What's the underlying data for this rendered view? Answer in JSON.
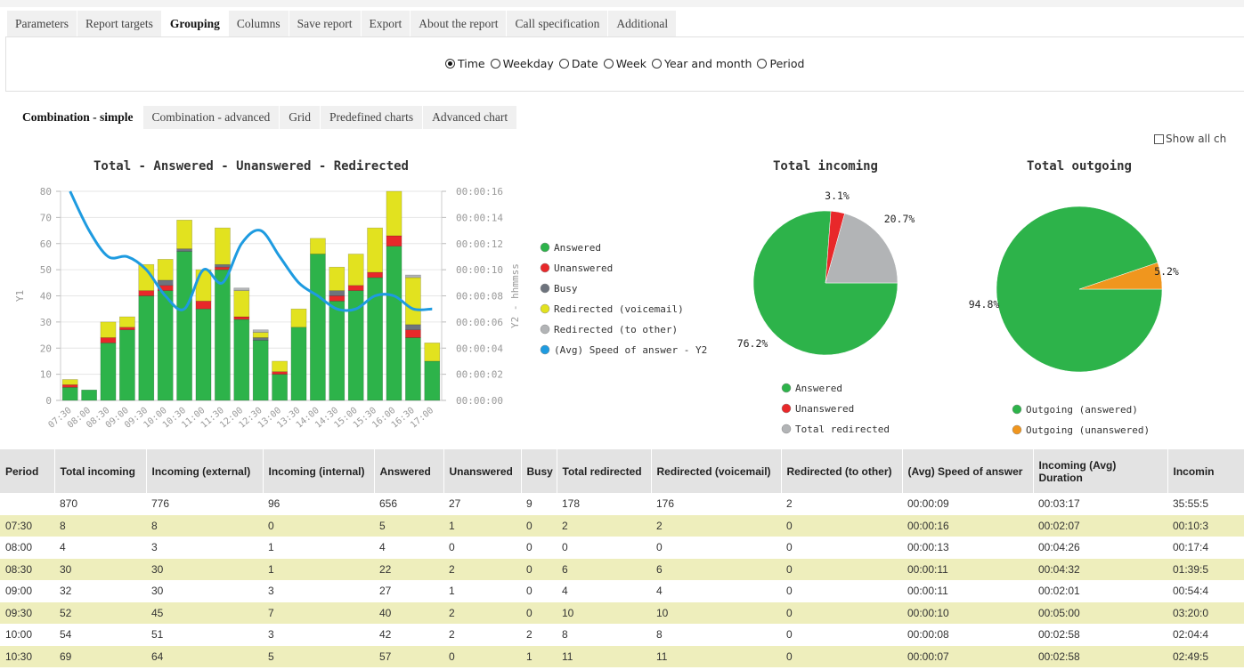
{
  "tabs_main": [
    "Parameters",
    "Report targets",
    "Grouping",
    "Columns",
    "Save report",
    "Export",
    "About the report",
    "Call specification",
    "Additional"
  ],
  "grouping_options": [
    "Time",
    "Weekday",
    "Date",
    "Week",
    "Year and month",
    "Period"
  ],
  "chart_tabs": [
    "Combination - simple",
    "Combination - advanced",
    "Grid",
    "Predefined charts",
    "Advanced chart"
  ],
  "show_all_label": "Show all ch",
  "chart_data": [
    {
      "type": "bar",
      "title": "Total - Answered - Unanswered - Redirected",
      "ylabel": "Y1",
      "y2label": "Y2 - hhmmss",
      "ylim": [
        0,
        80
      ],
      "yticks": [
        "0",
        "10",
        "20",
        "30",
        "40",
        "50",
        "60",
        "70",
        "80"
      ],
      "y2ticks": [
        "00:00:00",
        "00:00:02",
        "00:00:04",
        "00:00:06",
        "00:00:08",
        "00:00:10",
        "00:00:12",
        "00:00:14",
        "00:00:16"
      ],
      "categories": [
        "07:30",
        "08:00",
        "08:30",
        "09:00",
        "09:30",
        "10:00",
        "10:30",
        "11:00",
        "11:30",
        "12:00",
        "12:30",
        "13:00",
        "13:30",
        "14:00",
        "14:30",
        "15:00",
        "15:30",
        "16:00",
        "16:30",
        "17:00"
      ],
      "series": [
        {
          "name": "Answered",
          "color": "#2db34a",
          "values": [
            5,
            4,
            22,
            27,
            40,
            42,
            57,
            35,
            50,
            31,
            23,
            10,
            28,
            56,
            38,
            42,
            47,
            59,
            24,
            15
          ]
        },
        {
          "name": "Unanswered",
          "color": "#e8282a",
          "values": [
            1,
            0,
            2,
            1,
            2,
            2,
            0,
            3,
            1,
            1,
            0,
            1,
            0,
            0,
            2,
            2,
            2,
            4,
            3,
            0
          ]
        },
        {
          "name": "Busy",
          "color": "#6d737d",
          "values": [
            0,
            0,
            0,
            0,
            0,
            2,
            1,
            0,
            1,
            0,
            1,
            0,
            0,
            0,
            2,
            0,
            0,
            0,
            2,
            0
          ]
        },
        {
          "name": "Redirected (voicemail)",
          "color": "#e2e21f",
          "values": [
            2,
            0,
            6,
            4,
            10,
            8,
            11,
            12,
            14,
            10,
            2,
            4,
            7,
            6,
            9,
            12,
            17,
            17,
            18,
            7
          ]
        },
        {
          "name": "Redirected (to other)",
          "color": "#b2b4b6",
          "values": [
            0,
            0,
            0,
            0,
            0,
            0,
            0,
            0,
            0,
            1,
            1,
            0,
            0,
            0,
            0,
            0,
            0,
            0,
            1,
            0
          ]
        }
      ],
      "line": {
        "name": "(Avg) Speed of answer - Y2",
        "color": "#1e9be0",
        "values": [
          16,
          13,
          11,
          11,
          10,
          8,
          7,
          10,
          9,
          12,
          13,
          11,
          9,
          8,
          7,
          7,
          8,
          8,
          7,
          7
        ]
      }
    },
    {
      "type": "pie",
      "title": "Total incoming",
      "labels": [
        "Answered",
        "Unanswered",
        "Total redirected"
      ],
      "values": [
        76.2,
        3.1,
        20.7
      ],
      "value_labels": [
        "76.2%",
        "3.1%",
        "20.7%"
      ],
      "colors": [
        "#2db34a",
        "#e8282a",
        "#b2b4b6"
      ]
    },
    {
      "type": "pie",
      "title": "Total outgoing",
      "labels": [
        "Outgoing (answered)",
        "Outgoing (unanswered)"
      ],
      "values": [
        94.8,
        5.2
      ],
      "value_labels": [
        "94.8%",
        "5.2%"
      ],
      "colors": [
        "#2db34a",
        "#f0961e"
      ]
    }
  ],
  "table": {
    "headers": [
      "Period",
      "Total incoming",
      "Incoming (external)",
      "Incoming (internal)",
      "Answered",
      "Unanswered",
      "Busy",
      "Total redirected",
      "Redirected (voicemail)",
      "Redirected (to other)",
      "(Avg) Speed of answer",
      "Incoming (Avg) Duration",
      "Incomin"
    ],
    "rows": [
      [
        "",
        "870",
        "776",
        "96",
        "656",
        "27",
        "9",
        "178",
        "176",
        "2",
        "00:00:09",
        "00:03:17",
        "35:55:5"
      ],
      [
        "07:30",
        "8",
        "8",
        "0",
        "5",
        "1",
        "0",
        "2",
        "2",
        "0",
        "00:00:16",
        "00:02:07",
        "00:10:3"
      ],
      [
        "08:00",
        "4",
        "3",
        "1",
        "4",
        "0",
        "0",
        "0",
        "0",
        "0",
        "00:00:13",
        "00:04:26",
        "00:17:4"
      ],
      [
        "08:30",
        "30",
        "30",
        "1",
        "22",
        "2",
        "0",
        "6",
        "6",
        "0",
        "00:00:11",
        "00:04:32",
        "01:39:5"
      ],
      [
        "09:00",
        "32",
        "30",
        "3",
        "27",
        "1",
        "0",
        "4",
        "4",
        "0",
        "00:00:11",
        "00:02:01",
        "00:54:4"
      ],
      [
        "09:30",
        "52",
        "45",
        "7",
        "40",
        "2",
        "0",
        "10",
        "10",
        "0",
        "00:00:10",
        "00:05:00",
        "03:20:0"
      ],
      [
        "10:00",
        "54",
        "51",
        "3",
        "42",
        "2",
        "2",
        "8",
        "8",
        "0",
        "00:00:08",
        "00:02:58",
        "02:04:4"
      ],
      [
        "10:30",
        "69",
        "64",
        "5",
        "57",
        "0",
        "1",
        "11",
        "11",
        "0",
        "00:00:07",
        "00:02:58",
        "02:49:5"
      ]
    ]
  }
}
